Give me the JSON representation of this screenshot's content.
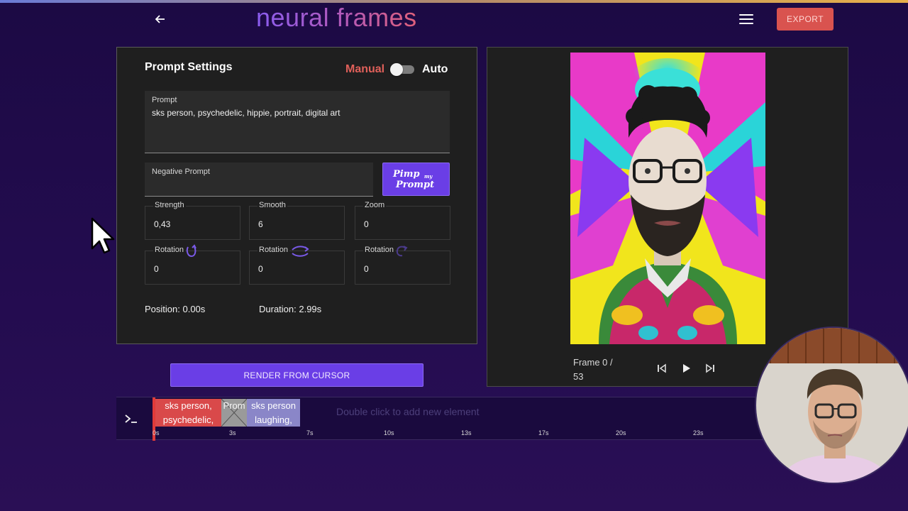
{
  "header": {
    "logo": "neural frames",
    "export_label": "EXPORT",
    "back_icon": "arrow-left-icon",
    "menu_icon": "hamburger-menu-icon"
  },
  "prompt_settings": {
    "title": "Prompt Settings",
    "mode_manual": "Manual",
    "mode_auto": "Auto",
    "toggle_state": "manual",
    "prompt_label": "Prompt",
    "prompt_value": "sks person, psychedelic, hippie, portrait, digital art",
    "negative_prompt_label": "Negative Prompt",
    "negative_prompt_value": "",
    "pimp_line1": "Pimp",
    "pimp_my": "my",
    "pimp_line2": "Prompt",
    "params": [
      {
        "label": "Strength",
        "value": "0,43"
      },
      {
        "label": "Smooth",
        "value": "6"
      },
      {
        "label": "Zoom",
        "value": "0"
      },
      {
        "label": "Rotation",
        "value": "0",
        "icon": "rotation-x-icon"
      },
      {
        "label": "Rotation",
        "value": "0",
        "icon": "rotation-y-icon"
      },
      {
        "label": "Rotation",
        "value": "0",
        "icon": "rotation-z-icon"
      }
    ],
    "position": "Position: 0.00s",
    "duration": "Duration: 2.99s"
  },
  "render_button": "RENDER FROM CURSOR",
  "preview": {
    "frame_line1": "Frame 0 /",
    "frame_line2": "53",
    "controls": [
      "skip-to-start-icon",
      "play-icon",
      "skip-to-end-icon"
    ]
  },
  "timeline": {
    "console_icon": "terminal-icon",
    "clips": [
      {
        "line1": "sks person,",
        "line2": "psychedelic,"
      },
      {
        "line1": "Prom",
        "line2": ""
      },
      {
        "line1": "sks person",
        "line2": "laughing,"
      }
    ],
    "hint": "Double click to add new element",
    "ticks": [
      "0s",
      "3s",
      "7s",
      "10s",
      "13s",
      "17s",
      "20s",
      "23s"
    ]
  },
  "colors": {
    "accent": "#6a3ee6",
    "export": "#d9534f",
    "manual": "#e0605a",
    "background": "#1c0a44",
    "playhead": "#e03a3a"
  }
}
